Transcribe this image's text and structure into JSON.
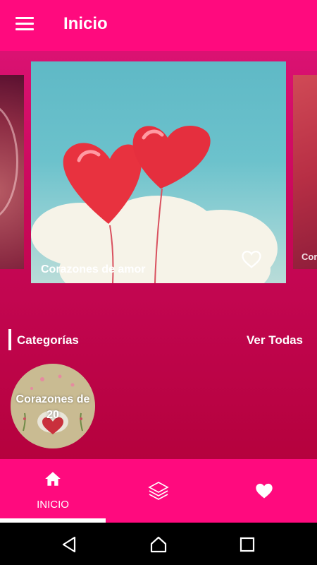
{
  "toolbar": {
    "title": "Inicio"
  },
  "carousel": {
    "left_label": "",
    "main_label": "Corazones de amor",
    "right_label": "Cor"
  },
  "categories": {
    "title": "Categorías",
    "see_all": "Ver Todas",
    "items": [
      {
        "label": "Corazones de 20"
      }
    ]
  },
  "bottom_nav": {
    "items": [
      {
        "label": "INICIO",
        "icon": "home-icon",
        "selected": true
      },
      {
        "label": "",
        "icon": "layers-icon",
        "selected": false
      },
      {
        "label": "",
        "icon": "heart-icon",
        "selected": false
      }
    ]
  },
  "colors": {
    "primary": "#ff0a7e",
    "gradient_top": "#e0157a",
    "gradient_bottom": "#b00036"
  }
}
